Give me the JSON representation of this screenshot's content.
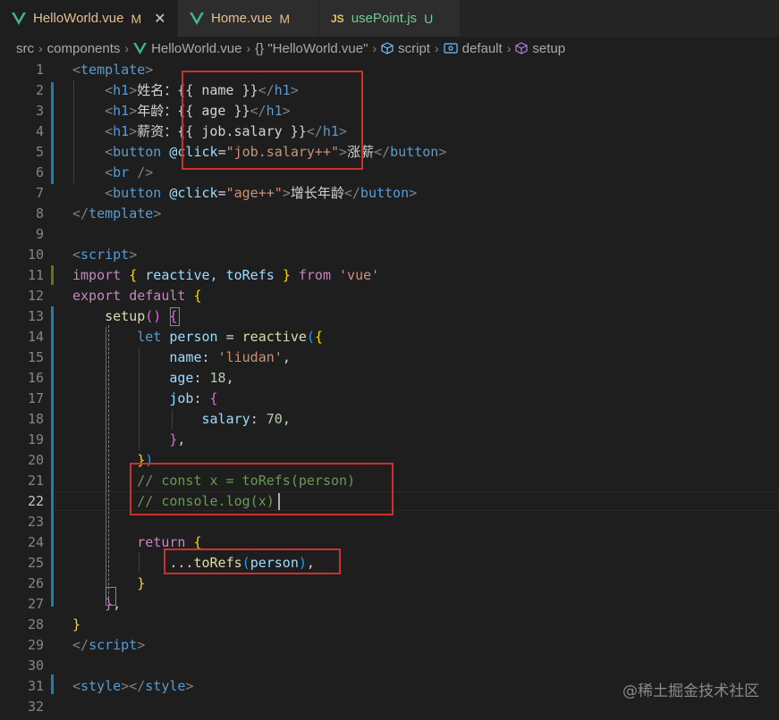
{
  "tabs": [
    {
      "label": "HelloWorld.vue",
      "badge": "M",
      "icon": "vue-icon",
      "active": true,
      "label_color": "#e2c08d",
      "badge_color": "#e2c08d"
    },
    {
      "label": "Home.vue",
      "badge": "M",
      "icon": "vue-icon",
      "active": false,
      "label_color": "#e2c08d",
      "badge_color": "#e2c08d"
    },
    {
      "label": "usePoint.js",
      "badge": "U",
      "icon": "js-icon",
      "active": false,
      "label_color": "#73c991",
      "badge_color": "#73c991"
    }
  ],
  "close_glyph": "✕",
  "js_icon_text": "JS",
  "breadcrumb": {
    "items": [
      "src",
      "components",
      "HelloWorld.vue",
      "{} \"HelloWorld.vue\"",
      "script",
      "default",
      "setup"
    ],
    "icons": [
      "",
      "",
      "vue-icon",
      "braces-icon",
      "cube-icon",
      "enum-icon",
      "cube-icon"
    ]
  },
  "editor": {
    "current_line": 22,
    "lines": [
      {
        "n": "1",
        "tokens": [
          [
            "<",
            "punc"
          ],
          [
            "template",
            "tag"
          ],
          [
            ">",
            "punc"
          ]
        ]
      },
      {
        "n": "2",
        "tokens": [
          [
            "    ",
            "txt"
          ],
          [
            "<",
            "punc"
          ],
          [
            "h1",
            "tag"
          ],
          [
            ">",
            "punc"
          ],
          [
            "姓名：{{ name }}",
            "txt"
          ],
          [
            "</",
            "punc"
          ],
          [
            "h1",
            "tag"
          ],
          [
            ">",
            "punc"
          ]
        ]
      },
      {
        "n": "3",
        "tokens": [
          [
            "    ",
            "txt"
          ],
          [
            "<",
            "punc"
          ],
          [
            "h1",
            "tag"
          ],
          [
            ">",
            "punc"
          ],
          [
            "年龄：{{ age }}",
            "txt"
          ],
          [
            "</",
            "punc"
          ],
          [
            "h1",
            "tag"
          ],
          [
            ">",
            "punc"
          ]
        ]
      },
      {
        "n": "4",
        "tokens": [
          [
            "    ",
            "txt"
          ],
          [
            "<",
            "punc"
          ],
          [
            "h1",
            "tag"
          ],
          [
            ">",
            "punc"
          ],
          [
            "薪资：{{ job.salary }}",
            "txt"
          ],
          [
            "</",
            "punc"
          ],
          [
            "h1",
            "tag"
          ],
          [
            ">",
            "punc"
          ]
        ]
      },
      {
        "n": "5",
        "tokens": [
          [
            "    ",
            "txt"
          ],
          [
            "<",
            "punc"
          ],
          [
            "button",
            "tag"
          ],
          [
            " ",
            "txt"
          ],
          [
            "@click",
            "attr"
          ],
          [
            "=",
            "txt"
          ],
          [
            "\"job.salary++\"",
            "str"
          ],
          [
            ">",
            "punc"
          ],
          [
            "涨薪",
            "txt"
          ],
          [
            "</",
            "punc"
          ],
          [
            "button",
            "tag"
          ],
          [
            ">",
            "punc"
          ]
        ]
      },
      {
        "n": "6",
        "tokens": [
          [
            "    ",
            "txt"
          ],
          [
            "<",
            "punc"
          ],
          [
            "br",
            "tag"
          ],
          [
            " />",
            "punc"
          ]
        ]
      },
      {
        "n": "7",
        "tokens": [
          [
            "    ",
            "txt"
          ],
          [
            "<",
            "punc"
          ],
          [
            "button",
            "tag"
          ],
          [
            " ",
            "txt"
          ],
          [
            "@click",
            "attr"
          ],
          [
            "=",
            "txt"
          ],
          [
            "\"age++\"",
            "str"
          ],
          [
            ">",
            "punc"
          ],
          [
            "增长年龄",
            "txt"
          ],
          [
            "</",
            "punc"
          ],
          [
            "button",
            "tag"
          ],
          [
            ">",
            "punc"
          ]
        ]
      },
      {
        "n": "8",
        "tokens": [
          [
            "</",
            "punc"
          ],
          [
            "template",
            "tag"
          ],
          [
            ">",
            "punc"
          ]
        ]
      },
      {
        "n": "9",
        "tokens": []
      },
      {
        "n": "10",
        "tokens": [
          [
            "<",
            "punc"
          ],
          [
            "script",
            "tag"
          ],
          [
            ">",
            "punc"
          ]
        ]
      },
      {
        "n": "11",
        "tokens": [
          [
            "import",
            "kw"
          ],
          [
            " ",
            "txt"
          ],
          [
            "{",
            "b1"
          ],
          [
            " reactive, toRefs ",
            "var"
          ],
          [
            "}",
            "b1"
          ],
          [
            " ",
            "txt"
          ],
          [
            "from",
            "kw"
          ],
          [
            " ",
            "txt"
          ],
          [
            "'vue'",
            "str"
          ]
        ]
      },
      {
        "n": "12",
        "tokens": [
          [
            "export",
            "kw"
          ],
          [
            " ",
            "txt"
          ],
          [
            "default",
            "kw"
          ],
          [
            " ",
            "txt"
          ],
          [
            "{",
            "b1"
          ]
        ]
      },
      {
        "n": "13",
        "tokens": [
          [
            "    ",
            "txt"
          ],
          [
            "setup",
            "fn"
          ],
          [
            "()",
            "b2"
          ],
          [
            " ",
            "txt"
          ],
          [
            "{",
            "b2"
          ]
        ]
      },
      {
        "n": "14",
        "tokens": [
          [
            "        ",
            "txt"
          ],
          [
            "let",
            "kw2"
          ],
          [
            " ",
            "txt"
          ],
          [
            "person",
            "var"
          ],
          [
            " = ",
            "txt"
          ],
          [
            "reactive",
            "fn"
          ],
          [
            "(",
            "b3"
          ],
          [
            "{",
            "b1"
          ]
        ]
      },
      {
        "n": "15",
        "tokens": [
          [
            "            ",
            "txt"
          ],
          [
            "name",
            "var"
          ],
          [
            ": ",
            "txt"
          ],
          [
            "'liudan'",
            "str"
          ],
          [
            ",",
            "txt"
          ]
        ]
      },
      {
        "n": "16",
        "tokens": [
          [
            "            ",
            "txt"
          ],
          [
            "age",
            "var"
          ],
          [
            ": ",
            "txt"
          ],
          [
            "18",
            "num"
          ],
          [
            ",",
            "txt"
          ]
        ]
      },
      {
        "n": "17",
        "tokens": [
          [
            "            ",
            "txt"
          ],
          [
            "job",
            "var"
          ],
          [
            ": ",
            "txt"
          ],
          [
            "{",
            "b2"
          ]
        ]
      },
      {
        "n": "18",
        "tokens": [
          [
            "                ",
            "txt"
          ],
          [
            "salary",
            "var"
          ],
          [
            ": ",
            "txt"
          ],
          [
            "70",
            "num"
          ],
          [
            ",",
            "txt"
          ]
        ]
      },
      {
        "n": "19",
        "tokens": [
          [
            "            ",
            "txt"
          ],
          [
            "}",
            "b2"
          ],
          [
            ",",
            "txt"
          ]
        ]
      },
      {
        "n": "20",
        "tokens": [
          [
            "        ",
            "txt"
          ],
          [
            "}",
            "b1"
          ],
          [
            ")",
            "b3"
          ]
        ]
      },
      {
        "n": "21",
        "tokens": [
          [
            "        ",
            "txt"
          ],
          [
            "// const x = toRefs(person)",
            "com"
          ]
        ]
      },
      {
        "n": "22",
        "tokens": [
          [
            "        ",
            "txt"
          ],
          [
            "// console.log(x)",
            "com"
          ]
        ]
      },
      {
        "n": "23",
        "tokens": []
      },
      {
        "n": "24",
        "tokens": [
          [
            "        ",
            "txt"
          ],
          [
            "return",
            "kw"
          ],
          [
            " ",
            "txt"
          ],
          [
            "{",
            "b1"
          ]
        ]
      },
      {
        "n": "25",
        "tokens": [
          [
            "            ",
            "txt"
          ],
          [
            "...",
            "txt"
          ],
          [
            "toRefs",
            "fn"
          ],
          [
            "(",
            "b3"
          ],
          [
            "person",
            "var"
          ],
          [
            ")",
            "b3"
          ],
          [
            ",",
            "txt"
          ]
        ]
      },
      {
        "n": "26",
        "tokens": [
          [
            "        ",
            "txt"
          ],
          [
            "}",
            "b1"
          ]
        ]
      },
      {
        "n": "27",
        "tokens": [
          [
            "    ",
            "txt"
          ],
          [
            "}",
            "b2"
          ],
          [
            ",",
            "txt"
          ]
        ]
      },
      {
        "n": "28",
        "tokens": [
          [
            "}",
            "b1"
          ]
        ]
      },
      {
        "n": "29",
        "tokens": [
          [
            "</",
            "punc"
          ],
          [
            "script",
            "tag"
          ],
          [
            ">",
            "punc"
          ]
        ]
      },
      {
        "n": "30",
        "tokens": []
      },
      {
        "n": "31",
        "tokens": [
          [
            "<",
            "punc"
          ],
          [
            "style",
            "tag"
          ],
          [
            "></",
            "punc"
          ],
          [
            "style",
            "tag"
          ],
          [
            ">",
            "punc"
          ]
        ]
      },
      {
        "n": "32",
        "tokens": []
      }
    ]
  },
  "watermark": "@稀土掘金技术社区",
  "colors": {
    "accent_box": "#d0302b",
    "git_modified": "#1b81a8",
    "git_added": "#587c0c"
  }
}
